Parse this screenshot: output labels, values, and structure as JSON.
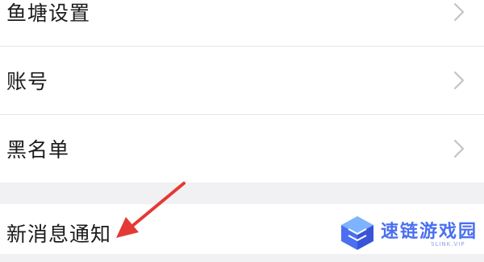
{
  "settings": {
    "items": [
      {
        "label": "鱼塘设置",
        "icon": "chevron-right-icon"
      },
      {
        "label": "账号",
        "icon": "chevron-right-icon"
      },
      {
        "label": "黑名单",
        "icon": "chevron-right-icon"
      }
    ],
    "notification": {
      "label": "新消息通知"
    }
  },
  "annotation": {
    "icon": "red-arrow-icon",
    "color": "#e53935"
  },
  "watermark": {
    "title": "速链游戏园",
    "subtitle": "SLINK.VIP",
    "icon": "cube-logo-icon",
    "color": "#4a6ff0"
  }
}
